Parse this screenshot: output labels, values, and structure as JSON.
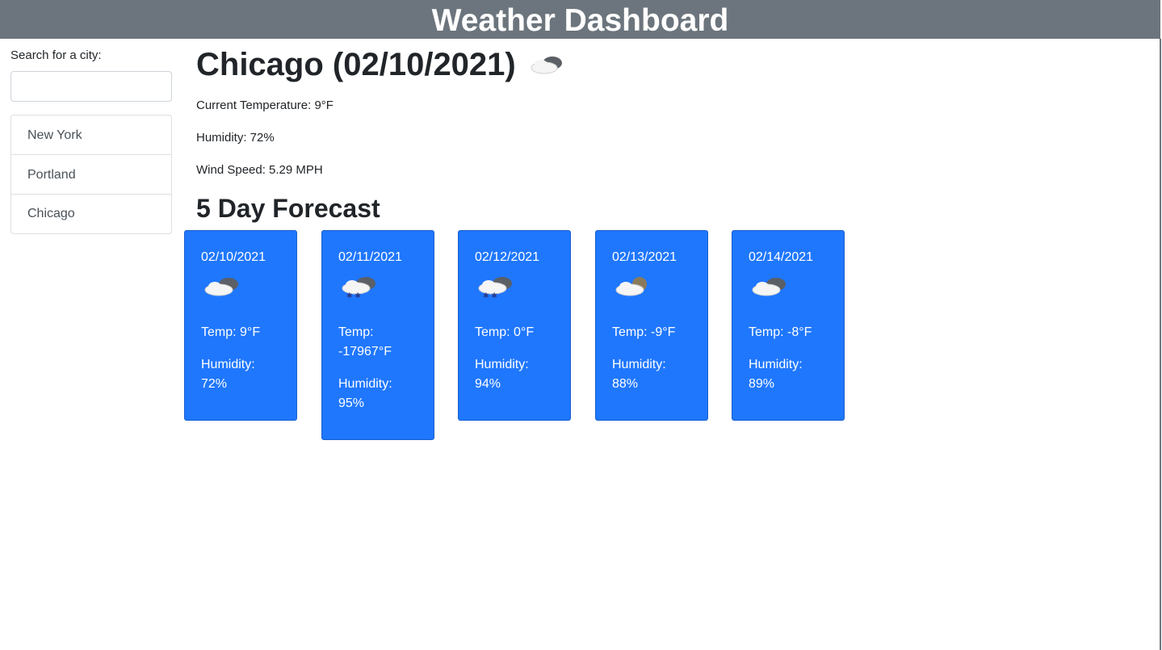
{
  "header": {
    "title": "Weather Dashboard"
  },
  "search": {
    "label": "Search for a city:",
    "value": "",
    "placeholder": ""
  },
  "history": [
    {
      "label": "New York"
    },
    {
      "label": "Portland"
    },
    {
      "label": "Chicago"
    }
  ],
  "current": {
    "title": "Chicago (02/10/2021)",
    "icon": "cloudy-icon",
    "temperature": "Current Temperature: 9°F",
    "humidity": "Humidity: 72%",
    "wind": "Wind Speed: 5.29 MPH"
  },
  "forecast": {
    "title": "5 Day Forecast",
    "days": [
      {
        "date": "02/10/2021",
        "icon": "cloudy-icon",
        "temp": "Temp: 9°F",
        "humidity": "Humidity: 72%"
      },
      {
        "date": "02/11/2021",
        "icon": "snow-cloud-icon",
        "temp": "Temp: -17967°F",
        "humidity": "Humidity: 95%"
      },
      {
        "date": "02/12/2021",
        "icon": "snow-cloud-icon",
        "temp": "Temp: 0°F",
        "humidity": "Humidity: 94%"
      },
      {
        "date": "02/13/2021",
        "icon": "partly-cloudy-icon",
        "temp": "Temp: -9°F",
        "humidity": "Humidity: 88%"
      },
      {
        "date": "02/14/2021",
        "icon": "cloudy-icon",
        "temp": "Temp: -8°F",
        "humidity": "Humidity: 89%"
      }
    ]
  },
  "colors": {
    "header_bg": "#6c757d",
    "card_bg": "#1f77fe"
  }
}
